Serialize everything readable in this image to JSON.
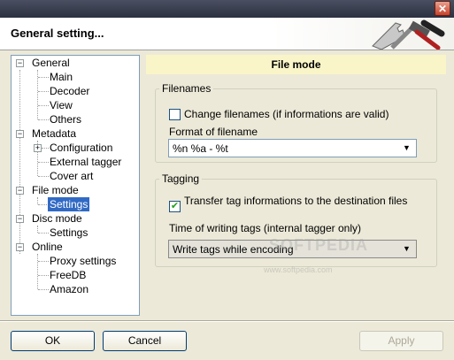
{
  "header": {
    "title": "General setting..."
  },
  "tree": {
    "items": [
      {
        "label": "General"
      },
      {
        "label": "Main"
      },
      {
        "label": "Decoder"
      },
      {
        "label": "View"
      },
      {
        "label": "Others"
      },
      {
        "label": "Metadata"
      },
      {
        "label": "Configuration"
      },
      {
        "label": "External tagger"
      },
      {
        "label": "Cover art"
      },
      {
        "label": "File mode"
      },
      {
        "label": "Settings"
      },
      {
        "label": "Disc mode"
      },
      {
        "label": "Settings"
      },
      {
        "label": "Online"
      },
      {
        "label": "Proxy settings"
      },
      {
        "label": "FreeDB"
      },
      {
        "label": "Amazon"
      }
    ]
  },
  "panel": {
    "title": "File mode",
    "filenames": {
      "group_label": "Filenames",
      "change_checkbox_label": "Change filenames (if informations are valid)",
      "change_checked": false,
      "format_label": "Format of filename",
      "format_value": "%n %a - %t"
    },
    "tagging": {
      "group_label": "Tagging",
      "transfer_checkbox_label": "Transfer tag informations to the destination files",
      "transfer_checked": true,
      "time_label": "Time of writing tags (internal tagger only)",
      "time_value": "Write tags while encoding"
    }
  },
  "buttons": {
    "ok": "OK",
    "cancel": "Cancel",
    "apply": "Apply"
  },
  "watermark": {
    "text": "SOFTPEDIA",
    "url": "www.softpedia.com"
  }
}
